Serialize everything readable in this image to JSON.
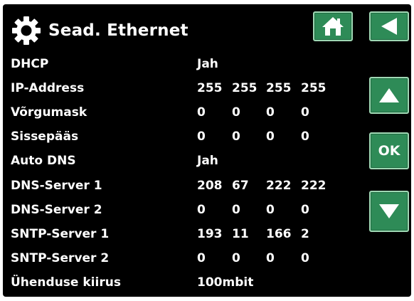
{
  "header": {
    "title": "Sead. Ethernet",
    "settings_icon": "gear-icon",
    "home_icon": "home-icon",
    "back_icon": "back-arrow-icon"
  },
  "nav": {
    "up_icon": "up-arrow-icon",
    "ok_label": "OK",
    "down_icon": "down-arrow-icon"
  },
  "colors": {
    "background": "#000000",
    "text": "#ffffff",
    "button": "#2e8b57",
    "button_border": "#9fd8b4"
  },
  "settings": [
    {
      "label": "DHCP",
      "values": [
        "Jah"
      ]
    },
    {
      "label": "IP-Address",
      "values": [
        "255",
        "255",
        "255",
        "255"
      ]
    },
    {
      "label": "Võrgumask",
      "values": [
        "0",
        "0",
        "0",
        "0"
      ]
    },
    {
      "label": "Sissepääs",
      "values": [
        "0",
        "0",
        "0",
        "0"
      ]
    },
    {
      "label": "Auto DNS",
      "values": [
        "Jah"
      ]
    },
    {
      "label": "DNS-Server 1",
      "values": [
        "208",
        "67",
        "222",
        "222"
      ]
    },
    {
      "label": "DNS-Server 2",
      "values": [
        "0",
        "0",
        "0",
        "0"
      ]
    },
    {
      "label": "SNTP-Server 1",
      "values": [
        "193",
        "11",
        "166",
        "2"
      ]
    },
    {
      "label": "SNTP-Server 2",
      "values": [
        "0",
        "0",
        "0",
        "0"
      ]
    },
    {
      "label": "Ühenduse kiirus",
      "values": [
        "100mbit"
      ]
    }
  ]
}
